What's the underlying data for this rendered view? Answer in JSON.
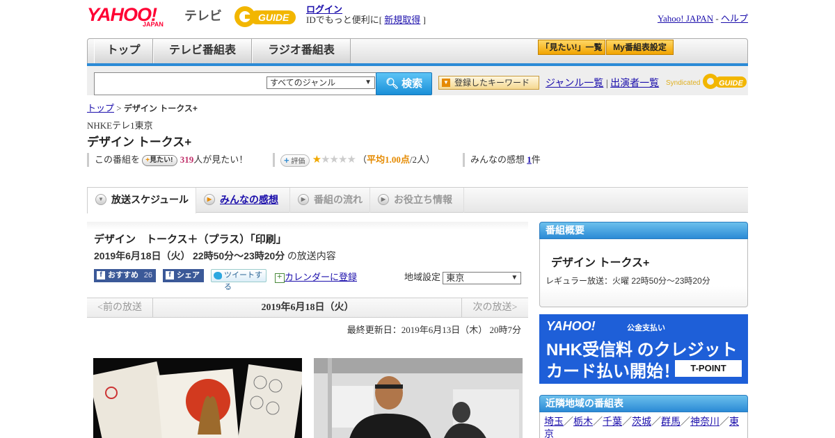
{
  "header": {
    "logo_yahoo": "YAHOO!",
    "logo_japan": "JAPAN",
    "logo_tv": "テレビ",
    "logo_guide": "GUIDE",
    "login_link": "ログイン",
    "login_note": "IDでもっと便利に[",
    "signup_link": "新規取得",
    "login_close": "]",
    "yahoo_link": "Yahoo! JAPAN",
    "sep": " - ",
    "help_link": "ヘルプ"
  },
  "nav": {
    "tabs": [
      "トップ",
      "テレビ番組表",
      "ラジオ番組表"
    ],
    "want_list": "「見たい!」一覧",
    "my_schedule": "My番組表設定"
  },
  "search": {
    "genre_select": "すべてのジャンル",
    "search_button": "検索",
    "keyword_button": "登録したキーワード",
    "genre_list": "ジャンル一覧",
    "divider": "|",
    "performer_list": "出演者一覧",
    "syndicated": "Syndicated",
    "syndicated_logo": "GUIDE"
  },
  "breadcrumb": {
    "top": "トップ",
    "sep": " > ",
    "current": "デザイン トークス+"
  },
  "program": {
    "station": "NHKEテレ1東京",
    "title": "デザイン トークス+",
    "want_prefix": "この番組を",
    "want_button": "見たい!",
    "want_count": "319",
    "want_suffix": "人が見たい！",
    "rate_button": "評価",
    "rating_stars": 1,
    "rating_open": "（",
    "rating_avg": "平均1.00点",
    "rating_count": "/2人）",
    "reviews_label": "みんなの感想",
    "reviews_count": "1",
    "reviews_suffix": "件"
  },
  "subtabs": [
    {
      "label": "放送スケジュール",
      "state": "active"
    },
    {
      "label": "みんなの感想",
      "state": "link"
    },
    {
      "label": "番組の流れ",
      "state": "disabled"
    },
    {
      "label": "お役立ち情報",
      "state": "disabled"
    }
  ],
  "episode": {
    "title": "デザイン　トークス＋（プラス）「印刷」",
    "date": "2019年6月18日（火）",
    "time": "22時50分～23時20分",
    "suffix": "の放送内容",
    "fb_label": "おすすめ",
    "fb_count": "26",
    "share_label": "シェア",
    "tweet_label": "ツイートする",
    "calendar_link": "カレンダーに登録",
    "region_label": "地域設定",
    "region_value": "東京"
  },
  "pager": {
    "prev": "<前の放送",
    "current": "2019年6月18日（火）",
    "next": "次の放送>"
  },
  "updated": "最終更新日：2019年6月13日（木）  20時7分",
  "sidebar": {
    "overview_header": "番組概要",
    "overview_title": "デザイン トークス+",
    "regular": "レギュラー放送：火曜 22時50分～23時20分",
    "ad": {
      "logo": "YAHOO!",
      "pay": "公金支払い",
      "line1": "NHK受信料 のクレジット",
      "line2": "カード払い開始！",
      "tpoint": "T-POINT"
    },
    "nearby_header": "近隣地域の番組表",
    "nearby": [
      "埼玉",
      "栃木",
      "千葉",
      "茨城",
      "群馬",
      "神奈川",
      "東京"
    ],
    "nearby_sep": "／"
  },
  "colors": {
    "accent_blue": "#2b8ad6",
    "yahoo_red": "#ff0033",
    "star_on": "#f0a800",
    "count_pink": "#c0306a"
  }
}
